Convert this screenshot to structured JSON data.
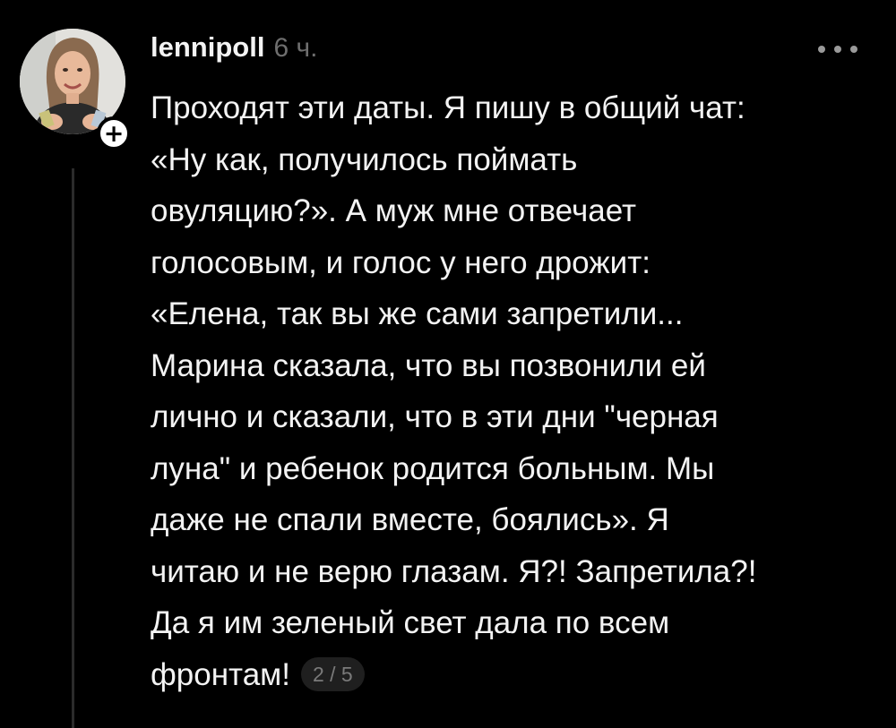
{
  "post": {
    "author": {
      "username": "lennipoll",
      "timestamp": "6 ч.",
      "avatar_icon": "user-avatar-photo",
      "follow_icon": "plus-icon",
      "follow_symbol": "+"
    },
    "more_icon": "ellipsis-icon",
    "body": "Проходят эти даты. Я пишу в общий чат:\n«Ну как, получилось поймать\nовуляцию?». А муж мне отвечает\nголосовым, и голос у него дрожит:\n«Елена, так вы же сами запретили...\nМарина сказала, что вы позвонили ей\nлично и сказали, что в эти дни \"черная\nлуна\" и ребенок родится больным. Мы\nдаже не спали вместе, боялись». Я\nчитаю и не верю глазам. Я?! Запретила?!\nДа я им зеленый свет дала по всем\nфронтам!",
    "page_indicator": "2 / 5"
  },
  "colors": {
    "background": "#000000",
    "text": "#f3f3f3",
    "muted": "#6e6e6e",
    "thread_line": "#2b2b2b",
    "badge_bg": "#1f1f1f"
  }
}
